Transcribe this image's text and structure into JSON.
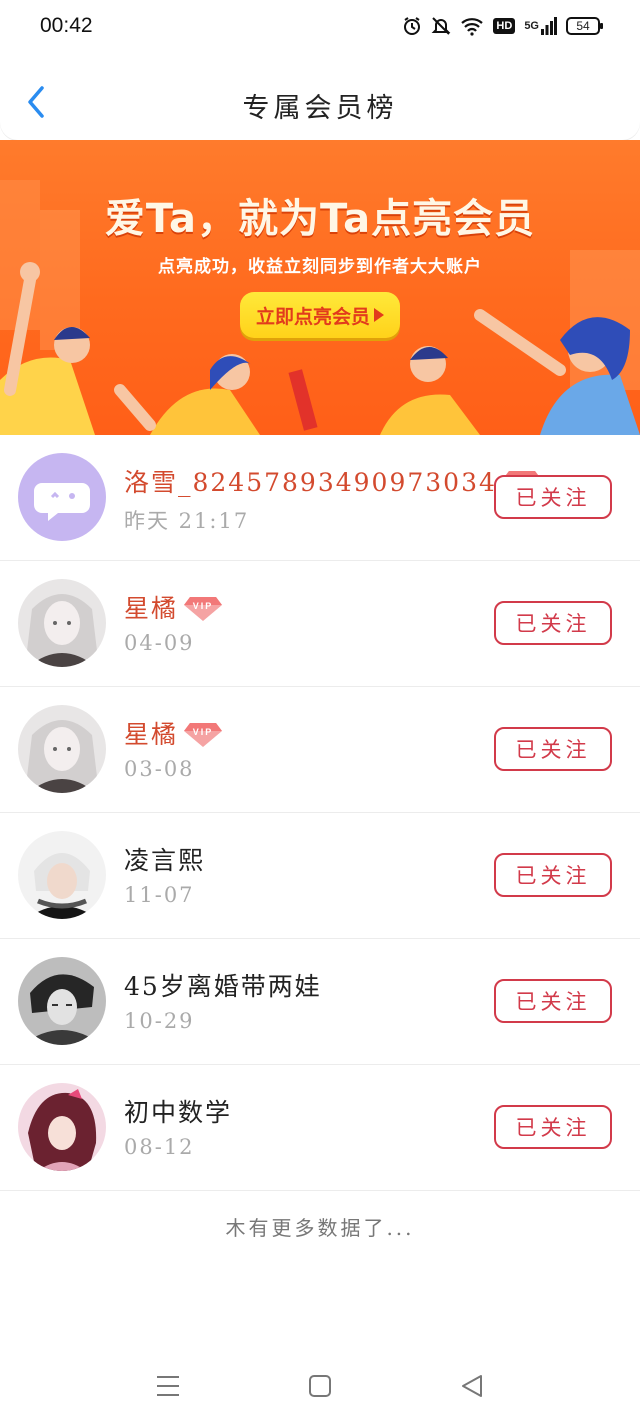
{
  "status_bar": {
    "time": "00:42",
    "network": "5G",
    "hd": "HD",
    "battery": "54"
  },
  "header": {
    "title": "专属会员榜"
  },
  "banner": {
    "title": "爱Ta，就为Ta点亮会员",
    "subtitle": "点亮成功，收益立刻同步到作者大大账户",
    "cta_label": "立即点亮会员"
  },
  "members": [
    {
      "name": "洛雪_824578934909730​34",
      "date": "昨天 21:17",
      "vip": true,
      "follow_label": "已关注",
      "avatar": "default-chat-avatar"
    },
    {
      "name": "星橘",
      "date": "04-09",
      "vip": true,
      "follow_label": "已关注",
      "avatar": "anime-girl-avatar"
    },
    {
      "name": "星橘",
      "date": "03-08",
      "vip": true,
      "follow_label": "已关注",
      "avatar": "anime-girl-avatar"
    },
    {
      "name": "凌言熙",
      "date": "11-07",
      "vip": false,
      "follow_label": "已关注",
      "avatar": "white-hair-avatar"
    },
    {
      "name": "45岁离婚带两娃",
      "date": "10-29",
      "vip": false,
      "follow_label": "已关注",
      "avatar": "anime-boy-avatar"
    },
    {
      "name": "初中数学",
      "date": "08-12",
      "vip": false,
      "follow_label": "已关注",
      "avatar": "anime-red-hair-avatar"
    }
  ],
  "footer": {
    "no_more": "木有更多数据了..."
  },
  "colors": {
    "accent_blue": "#2a8cf0",
    "vip_name": "#d34a2e",
    "follow_border": "#d23a4a",
    "banner_orange": "#ff6a1e",
    "cta_yellow": "#ffd21a"
  }
}
